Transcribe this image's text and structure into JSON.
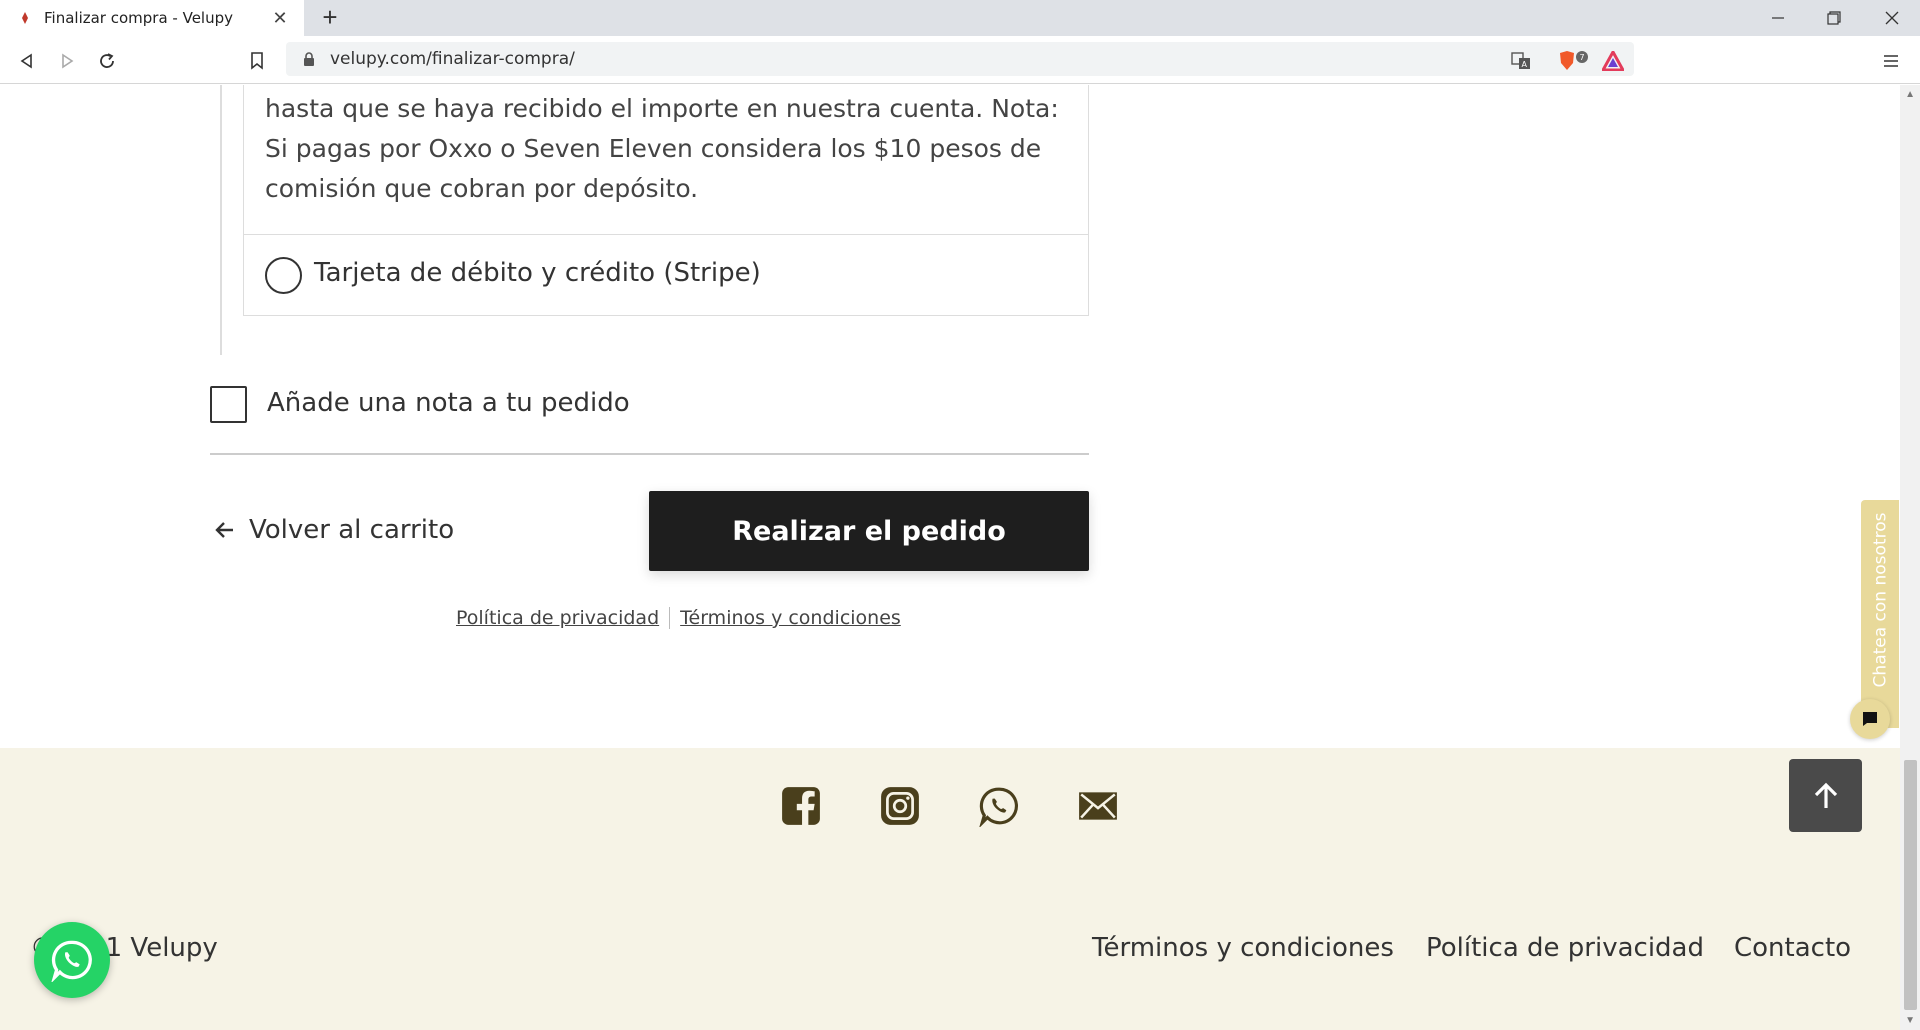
{
  "browser": {
    "tab_title": "Finalizar compra - Velupy",
    "url": "velupy.com/finalizar-compra/",
    "new_tab_symbol": "+",
    "shields_count": "7"
  },
  "payment": {
    "description": "hasta que se haya recibido el importe en nuestra cuenta. Nota: Si pagas por Oxxo o Seven Eleven considera los $10 pesos de comisión que cobran por depósito.",
    "stripe_option_label": "Tarjeta de débito y crédito (Stripe)"
  },
  "order_note": {
    "label": "Añade una nota a tu pedido"
  },
  "actions": {
    "back_label": "Volver al carrito",
    "place_order_label": "Realizar el pedido"
  },
  "legal": {
    "privacy": "Política de privacidad",
    "terms": "Términos y condiciones"
  },
  "footer": {
    "copyright": "©2021 Velupy",
    "links": {
      "terms": "Términos y condiciones",
      "privacy": "Política de privacidad",
      "contact": "Contacto"
    }
  },
  "chat": {
    "tab_label": "Chatea con nosotros"
  },
  "colors": {
    "footer_bg": "#f6f3e6",
    "icon_color": "#4a3f1c",
    "button_bg": "#1e1e1e",
    "chat_accent": "#e8d99a",
    "whatsapp_green": "#25d366"
  },
  "icons": [
    "facebook-icon",
    "instagram-icon",
    "whatsapp-icon",
    "mail-icon"
  ]
}
